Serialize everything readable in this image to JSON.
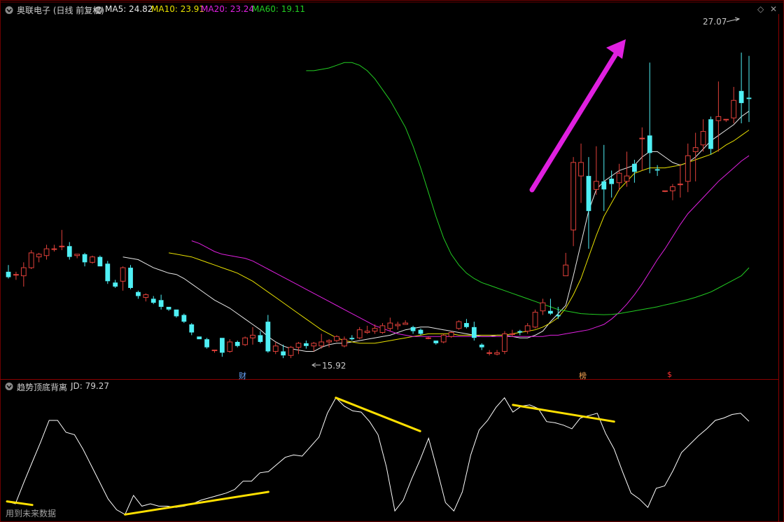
{
  "colors": {
    "background": "#000000",
    "border": "#8b0000",
    "up_candle": "#e0403a",
    "down_candle": "#4ff0f5",
    "ma5": "#e8e8e8",
    "ma10": "#e8e000",
    "ma20": "#e020e0",
    "ma60": "#22cc22",
    "indicator_line": "#ffffff",
    "divergence_line": "#ffe000",
    "annotation_arrow": "#e020e0"
  },
  "header": {
    "stock_name": "奥联电子 (日线 前复权)",
    "ma5": "MA5: 24.82",
    "ma10": "MA10: 23.91",
    "ma20": "MA20: 23.24",
    "ma60": "MA60: 19.11",
    "diamond_icon": "◇",
    "close_icon": "✕"
  },
  "price_panel": {
    "high_label": "27.07",
    "low_label": "15.92",
    "event_markers": [
      {
        "text": "财",
        "color": "#6aa8ff"
      },
      {
        "text": "榜",
        "color": "#f0a050"
      },
      {
        "text": "$",
        "color": "#ff3030"
      }
    ]
  },
  "indicator_panel": {
    "name": "趋势顶底背离",
    "value_label": "JD: 79.27",
    "footer_note": "用到未来数据"
  },
  "chart_data": {
    "type": "candlestick",
    "price_axis_range": [
      15.0,
      28.5
    ],
    "candles": [
      [
        18.95,
        19.2,
        18.7,
        18.75
      ],
      [
        18.85,
        18.95,
        18.65,
        18.85
      ],
      [
        18.8,
        19.3,
        18.4,
        19.1
      ],
      [
        19.1,
        19.75,
        19.05,
        19.65
      ],
      [
        19.5,
        19.65,
        19.3,
        19.6
      ],
      [
        19.55,
        19.95,
        19.4,
        19.8
      ],
      [
        19.8,
        19.95,
        19.7,
        19.8
      ],
      [
        19.9,
        20.5,
        19.75,
        19.9
      ],
      [
        19.9,
        20.05,
        19.4,
        19.5
      ],
      [
        19.55,
        19.6,
        19.45,
        19.6
      ],
      [
        19.6,
        19.65,
        19.15,
        19.3
      ],
      [
        19.3,
        19.55,
        19.25,
        19.5
      ],
      [
        19.5,
        19.55,
        19.15,
        19.15
      ],
      [
        19.25,
        19.35,
        18.5,
        18.6
      ],
      [
        18.55,
        18.65,
        18.35,
        18.4
      ],
      [
        18.6,
        19.15,
        18.25,
        19.1
      ],
      [
        19.1,
        19.2,
        18.3,
        18.35
      ],
      [
        18.2,
        18.25,
        17.95,
        18.05
      ],
      [
        18.0,
        18.15,
        17.85,
        18.1
      ],
      [
        17.95,
        18.05,
        17.75,
        17.8
      ],
      [
        17.9,
        18.1,
        17.55,
        17.65
      ],
      [
        17.65,
        17.65,
        17.5,
        17.55
      ],
      [
        17.55,
        17.55,
        17.25,
        17.3
      ],
      [
        17.35,
        17.4,
        17.05,
        17.1
      ],
      [
        17.0,
        17.05,
        16.6,
        16.7
      ],
      [
        16.55,
        16.55,
        16.45,
        16.45
      ],
      [
        16.45,
        16.5,
        16.1,
        16.15
      ],
      [
        16.05,
        16.05,
        15.95,
        16.05
      ],
      [
        16.5,
        16.5,
        15.8,
        15.95
      ],
      [
        16.0,
        16.45,
        15.95,
        16.35
      ],
      [
        16.35,
        16.4,
        16.15,
        16.2
      ],
      [
        16.25,
        16.55,
        16.2,
        16.5
      ],
      [
        16.5,
        16.9,
        16.25,
        16.6
      ],
      [
        16.6,
        16.75,
        16.3,
        16.35
      ],
      [
        17.1,
        17.35,
        15.95,
        16.0
      ],
      [
        16.0,
        16.35,
        15.9,
        16.2
      ],
      [
        16.0,
        16.25,
        15.75,
        15.85
      ],
      [
        15.85,
        16.2,
        15.75,
        16.15
      ],
      [
        16.15,
        16.35,
        15.9,
        16.3
      ],
      [
        16.3,
        16.4,
        16.1,
        16.2
      ],
      [
        16.2,
        16.35,
        16.0,
        16.3
      ],
      [
        16.2,
        16.65,
        16.1,
        16.35
      ],
      [
        16.35,
        16.45,
        16.15,
        16.4
      ],
      [
        16.4,
        16.6,
        16.35,
        16.55
      ],
      [
        16.2,
        16.55,
        16.15,
        16.45
      ],
      [
        16.5,
        16.6,
        16.4,
        16.45
      ],
      [
        16.5,
        16.9,
        16.45,
        16.8
      ],
      [
        16.7,
        16.95,
        16.65,
        16.75
      ],
      [
        16.75,
        17.0,
        16.65,
        16.85
      ],
      [
        16.7,
        17.05,
        16.65,
        16.95
      ],
      [
        16.85,
        17.25,
        16.75,
        17.05
      ],
      [
        16.95,
        17.1,
        16.8,
        17.0
      ],
      [
        17.0,
        17.15,
        17.0,
        17.05
      ],
      [
        16.9,
        16.95,
        16.65,
        16.75
      ],
      [
        16.8,
        16.85,
        16.6,
        16.65
      ],
      [
        16.5,
        16.55,
        16.45,
        16.5
      ],
      [
        16.4,
        16.4,
        16.25,
        16.3
      ],
      [
        16.35,
        16.65,
        16.3,
        16.6
      ],
      [
        16.55,
        16.75,
        16.5,
        16.7
      ],
      [
        16.85,
        17.15,
        16.8,
        17.1
      ],
      [
        17.05,
        17.2,
        16.85,
        16.9
      ],
      [
        16.9,
        17.1,
        16.4,
        16.5
      ],
      [
        16.25,
        16.3,
        16.05,
        16.15
      ],
      [
        15.95,
        16.05,
        15.85,
        15.95
      ],
      [
        15.9,
        16.05,
        15.85,
        15.95
      ],
      [
        16.0,
        16.75,
        15.9,
        16.65
      ],
      [
        16.65,
        16.8,
        16.55,
        16.65
      ],
      [
        16.75,
        16.8,
        16.6,
        16.7
      ],
      [
        16.75,
        17.05,
        16.65,
        16.95
      ],
      [
        16.9,
        17.55,
        16.85,
        17.45
      ],
      [
        17.5,
        17.95,
        17.35,
        17.8
      ],
      [
        17.5,
        17.95,
        17.35,
        17.4
      ],
      [
        17.35,
        17.65,
        17.2,
        17.3
      ],
      [
        18.8,
        19.65,
        18.8,
        19.2
      ],
      [
        20.5,
        23.2,
        19.9,
        23.0
      ],
      [
        22.5,
        23.7,
        21.5,
        23.0
      ],
      [
        22.5,
        23.2,
        19.8,
        21.2
      ],
      [
        22.0,
        23.6,
        21.8,
        22.3
      ],
      [
        22.3,
        23.65,
        21.2,
        22.0
      ],
      [
        22.4,
        22.7,
        21.7,
        22.2
      ],
      [
        22.25,
        22.95,
        21.95,
        22.6
      ],
      [
        22.3,
        23.4,
        22.1,
        22.5
      ],
      [
        22.95,
        23.1,
        22.25,
        22.65
      ],
      [
        23.9,
        24.3,
        22.7,
        23.9
      ],
      [
        24.0,
        26.7,
        22.6,
        23.35
      ],
      [
        22.75,
        22.9,
        22.5,
        22.7
      ],
      [
        21.95,
        21.95,
        21.9,
        21.95
      ],
      [
        21.95,
        22.2,
        21.6,
        22.1
      ],
      [
        22.2,
        22.95,
        21.7,
        22.2
      ],
      [
        22.3,
        23.7,
        21.9,
        23.25
      ],
      [
        23.4,
        24.1,
        22.3,
        23.55
      ],
      [
        23.65,
        24.6,
        23.4,
        24.15
      ],
      [
        24.6,
        24.7,
        23.3,
        23.5
      ],
      [
        24.55,
        26.0,
        23.4,
        24.7
      ],
      [
        24.6,
        24.6,
        24.5,
        24.6
      ],
      [
        24.65,
        25.8,
        24.45,
        25.3
      ],
      [
        25.65,
        27.07,
        24.45,
        25.2
      ],
      [
        25.4,
        26.95,
        24.5,
        25.35
      ]
    ],
    "ma_series": {
      "MA5": [
        19.5,
        19.45,
        19.4,
        19.25,
        19.1,
        19.0,
        18.9,
        18.85,
        18.7,
        18.5,
        18.3,
        18.1,
        17.9,
        17.75,
        17.6,
        17.4,
        17.2,
        17.0,
        16.8,
        16.55,
        16.35,
        16.2,
        16.1,
        16.05,
        16.0,
        16.0,
        16.15,
        16.25,
        16.3,
        16.3,
        16.35,
        16.4,
        16.45,
        16.5,
        16.55,
        16.6,
        16.7,
        16.8,
        16.85,
        16.9,
        16.9,
        16.85,
        16.8,
        16.75,
        16.7,
        16.65,
        16.6,
        16.55,
        16.55,
        16.6,
        16.6,
        16.55,
        16.5,
        16.5,
        16.6,
        16.75,
        17.1,
        17.4,
        17.7,
        18.8,
        20.0,
        21.2,
        22.0,
        22.3,
        22.5,
        22.7,
        22.8,
        22.9,
        23.2,
        23.4,
        23.4,
        23.2,
        23.0,
        22.9,
        23.0,
        23.2,
        23.5,
        23.8,
        24.0,
        24.2,
        24.4,
        24.7,
        24.9
      ],
      "MA10": [
        19.65,
        19.6,
        19.55,
        19.5,
        19.4,
        19.3,
        19.2,
        19.1,
        19.0,
        18.9,
        18.75,
        18.6,
        18.4,
        18.2,
        18.0,
        17.8,
        17.6,
        17.4,
        17.2,
        17.0,
        16.8,
        16.65,
        16.5,
        16.4,
        16.35,
        16.3,
        16.3,
        16.3,
        16.35,
        16.4,
        16.45,
        16.5,
        16.55,
        16.6,
        16.65,
        16.65,
        16.65,
        16.65,
        16.6,
        16.6,
        16.6,
        16.6,
        16.6,
        16.6,
        16.6,
        16.65,
        16.7,
        16.75,
        16.8,
        16.9,
        17.05,
        17.25,
        17.6,
        18.1,
        18.7,
        19.5,
        20.3,
        21.0,
        21.5,
        22.0,
        22.3,
        22.6,
        22.7,
        22.8,
        22.8,
        22.8,
        22.85,
        22.9,
        23.0,
        23.1,
        23.2,
        23.3,
        23.45,
        23.65,
        23.8,
        24.0,
        24.2
      ],
      "MA20": [
        20.1,
        20.0,
        19.85,
        19.7,
        19.6,
        19.55,
        19.5,
        19.45,
        19.35,
        19.2,
        19.05,
        18.9,
        18.75,
        18.6,
        18.45,
        18.3,
        18.15,
        18.0,
        17.85,
        17.7,
        17.55,
        17.4,
        17.25,
        17.1,
        16.95,
        16.85,
        16.75,
        16.65,
        16.6,
        16.55,
        16.55,
        16.55,
        16.55,
        16.55,
        16.55,
        16.55,
        16.55,
        16.55,
        16.55,
        16.55,
        16.55,
        16.55,
        16.55,
        16.55,
        16.55,
        16.55,
        16.55,
        16.6,
        16.6,
        16.65,
        16.7,
        16.75,
        16.8,
        16.9,
        17.0,
        17.2,
        17.45,
        17.75,
        18.1,
        18.5,
        18.95,
        19.4,
        19.8,
        20.25,
        20.7,
        21.1,
        21.4,
        21.7,
        22.0,
        22.3,
        22.55,
        22.8,
        23.05,
        23.25
      ],
      "MA60": [
        26.4,
        26.4,
        26.45,
        26.5,
        26.6,
        26.7,
        26.7,
        26.6,
        26.4,
        26.1,
        25.7,
        25.3,
        24.8,
        24.3,
        23.6,
        22.8,
        21.9,
        21.0,
        20.2,
        19.6,
        19.2,
        18.9,
        18.7,
        18.55,
        18.45,
        18.35,
        18.25,
        18.15,
        18.05,
        17.95,
        17.85,
        17.75,
        17.65,
        17.55,
        17.5,
        17.45,
        17.4,
        17.38,
        17.37,
        17.36,
        17.37,
        17.4,
        17.45,
        17.5,
        17.55,
        17.6,
        17.65,
        17.72,
        17.78,
        17.85,
        17.92,
        18.0,
        18.1,
        18.2,
        18.35,
        18.5,
        18.65,
        18.8,
        19.1
      ]
    },
    "indicator": {
      "name": "趋势顶底背离",
      "range": [
        0,
        100
      ],
      "JD": [
        12,
        10,
        28,
        45,
        62,
        80,
        80,
        70,
        68,
        56,
        42,
        28,
        14,
        5,
        1,
        17,
        8,
        10,
        8,
        8,
        7,
        8,
        10,
        13,
        15,
        17,
        19,
        22,
        29,
        29,
        36,
        37,
        43,
        49,
        51,
        50,
        58,
        66,
        86,
        99,
        92,
        88,
        87,
        79,
        68,
        41,
        4,
        13,
        31,
        47,
        65,
        39,
        11,
        4,
        20,
        51,
        72,
        80,
        91,
        99,
        87,
        92,
        93,
        90,
        79,
        78,
        76,
        73,
        82,
        84,
        86,
        69,
        56,
        37,
        19,
        14,
        7,
        23,
        25,
        38,
        53,
        60,
        67,
        73,
        80,
        82,
        85,
        86,
        79.27
      ],
      "divergence_lines": [
        {
          "type": "bottom",
          "from": [
            0,
            12
          ],
          "to": [
            3,
            9
          ]
        },
        {
          "type": "bottom",
          "from": [
            14,
            1
          ],
          "to": [
            31,
            20
          ]
        },
        {
          "type": "top",
          "from": [
            39,
            99
          ],
          "to": [
            49,
            71
          ]
        },
        {
          "type": "top",
          "from": [
            60,
            93
          ],
          "to": [
            72,
            79
          ]
        }
      ]
    }
  }
}
